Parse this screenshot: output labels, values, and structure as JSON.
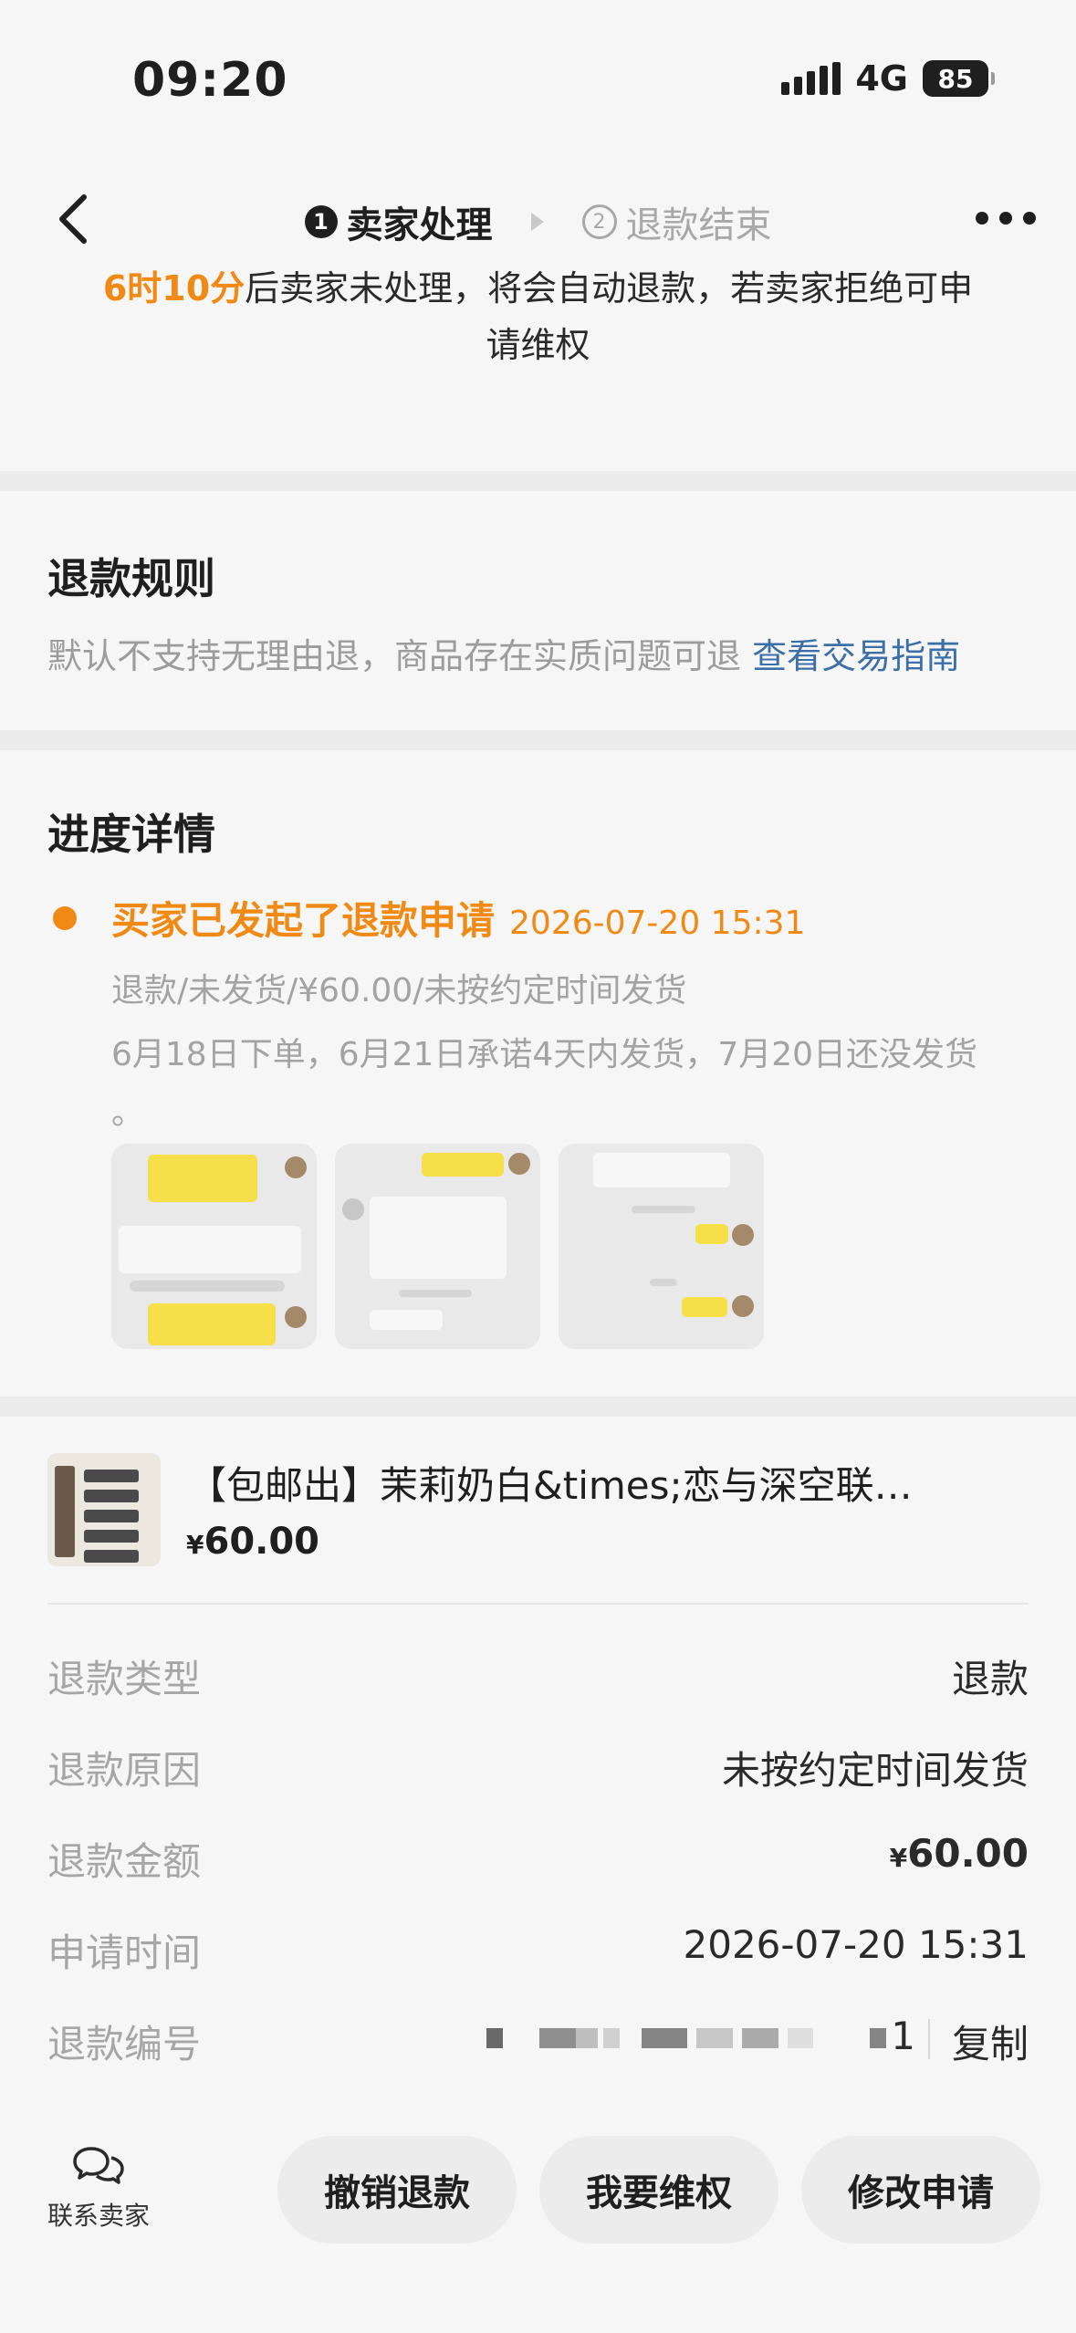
{
  "status_bar": {
    "time": "09:20",
    "network": "4G",
    "battery": "85"
  },
  "nav": {
    "step1_number": "1",
    "step1_label": "卖家处理",
    "step2_number": "2",
    "step2_label": "退款结束"
  },
  "notice": {
    "countdown": "6时10分",
    "text_line1": "后卖家未处理，将会自动退款，若卖家拒绝可申",
    "text_line2": "请维权"
  },
  "rules": {
    "title": "退款规则",
    "text": "默认不支持无理由退，商品存在实质问题可退",
    "link": "查看交易指南"
  },
  "progress": {
    "title": "进度详情",
    "event_title": "买家已发起了退款申请",
    "event_time": "2026-07-20 15:31",
    "line1": "退款/未发货/¥60.00/未按约定时间发货",
    "line2": "6月18日下单，6月21日承诺4天内发货，7月20日还没发货",
    "line3": "。"
  },
  "product": {
    "title": "【包邮出】茉莉奶白&times;恋与深空联…",
    "currency": "¥",
    "price": "60.00"
  },
  "details": [
    {
      "label": "退款类型",
      "value": "退款"
    },
    {
      "label": "退款原因",
      "value": "未按约定时间发货"
    },
    {
      "label": "退款金额",
      "currency": "¥",
      "value": "60.00"
    },
    {
      "label": "申请时间",
      "value": "2026-07-20 15:31"
    },
    {
      "label": "退款编号",
      "value_suffix": "1",
      "copy": "复制"
    }
  ],
  "bottom": {
    "contact_label": "联系卖家",
    "cancel": "撤销退款",
    "dispute": "我要维权",
    "modify": "修改申请"
  },
  "colors": {
    "accent": "#f08a14",
    "link": "#3a6fa8"
  }
}
